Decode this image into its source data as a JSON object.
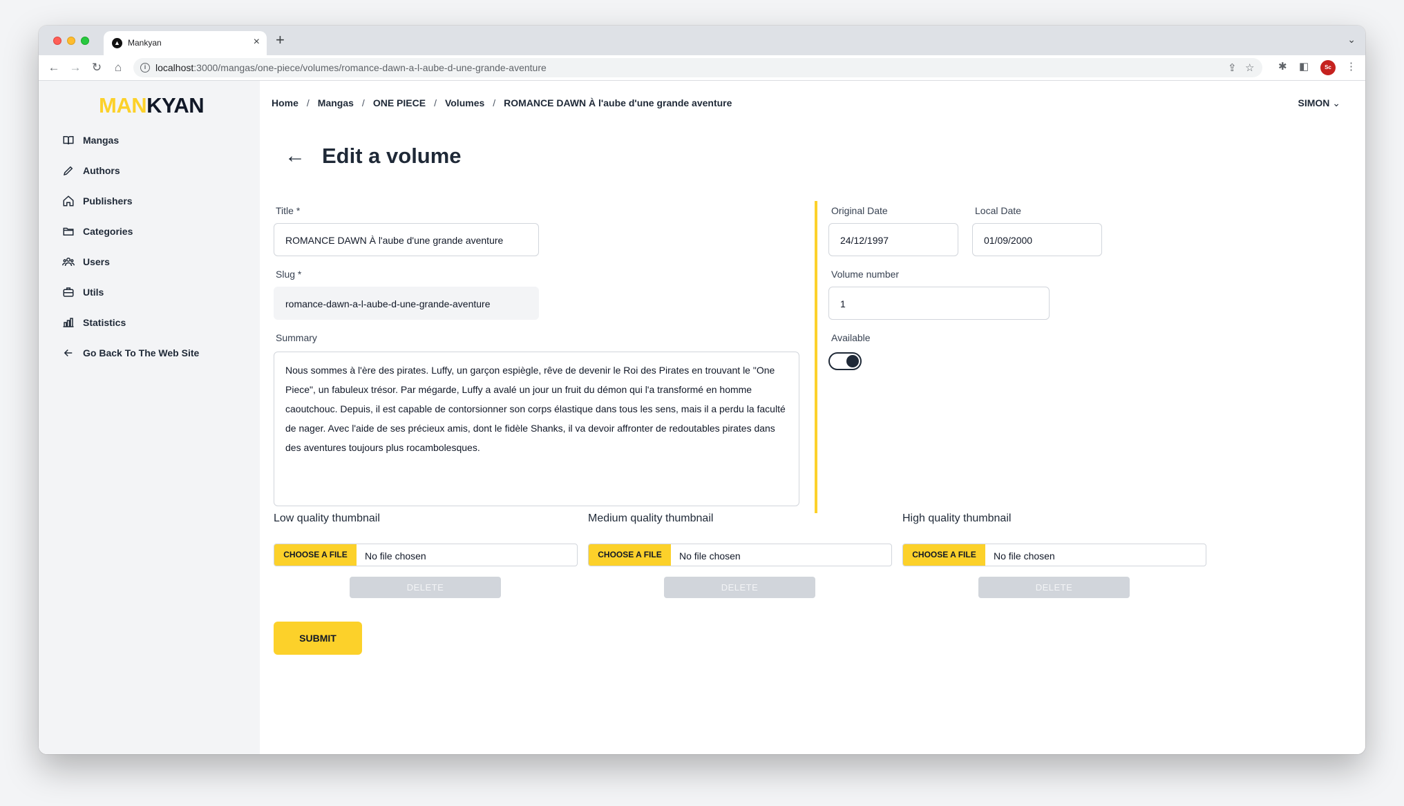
{
  "browser": {
    "tab_title": "Mankyan",
    "url_host": "localhost",
    "url_path": ":3000/mangas/one-piece/volumes/romance-dawn-a-l-aube-d-une-grande-aventure",
    "profile_initials": "Sc"
  },
  "logo": {
    "part1": "MAN",
    "part2": "KYAN"
  },
  "sidebar": {
    "items": [
      {
        "label": "Mangas",
        "icon": "book-icon"
      },
      {
        "label": "Authors",
        "icon": "pencil-icon"
      },
      {
        "label": "Publishers",
        "icon": "home-icon"
      },
      {
        "label": "Categories",
        "icon": "folder-icon"
      },
      {
        "label": "Users",
        "icon": "users-icon"
      },
      {
        "label": "Utils",
        "icon": "briefcase-icon"
      },
      {
        "label": "Statistics",
        "icon": "bar-chart-icon"
      },
      {
        "label": "Go Back To The Web Site",
        "icon": "arrow-left-icon"
      }
    ]
  },
  "breadcrumb": [
    "Home",
    "Mangas",
    "ONE PIECE",
    "Volumes",
    "ROMANCE DAWN À l'aube d'une grande aventure"
  ],
  "user_menu": {
    "label": "SIMON"
  },
  "page": {
    "title": "Edit a volume"
  },
  "form": {
    "title_label": "Title *",
    "title_value": "ROMANCE DAWN À l'aube d'une grande aventure",
    "slug_label": "Slug *",
    "slug_value": "romance-dawn-a-l-aube-d-une-grande-aventure",
    "summary_label": "Summary",
    "summary_value": "Nous sommes à l'ère des pirates. Luffy, un garçon espiègle, rêve de devenir le Roi des Pirates en trouvant le \"One Piece\", un fabuleux trésor. Par mégarde, Luffy a avalé un jour un fruit du démon qui l'a transformé en homme caoutchouc. Depuis, il est capable de contorsionner son corps élastique dans tous les sens, mais il a perdu la faculté de nager. Avec l'aide de ses précieux amis, dont le fidèle Shanks, il va devoir affronter de redoutables pirates dans des aventures toujours plus rocambolesques.",
    "original_date_label": "Original Date",
    "original_date_value": "24/12/1997",
    "local_date_label": "Local Date",
    "local_date_value": "01/09/2000",
    "volume_number_label": "Volume number",
    "volume_number_value": "1",
    "available_label": "Available",
    "available": true
  },
  "thumbnails": [
    {
      "label": "Low quality thumbnail",
      "choose": "CHOOSE A FILE",
      "status": "No file chosen",
      "delete": "DELETE"
    },
    {
      "label": "Medium quality thumbnail",
      "choose": "CHOOSE A FILE",
      "status": "No file chosen",
      "delete": "DELETE"
    },
    {
      "label": "High quality thumbnail",
      "choose": "CHOOSE A FILE",
      "status": "No file chosen",
      "delete": "DELETE"
    }
  ],
  "submit_label": "SUBMIT",
  "colors": {
    "accent": "#fcd12a",
    "dark": "#1f2937",
    "sidebar_bg": "#f3f4f6"
  }
}
